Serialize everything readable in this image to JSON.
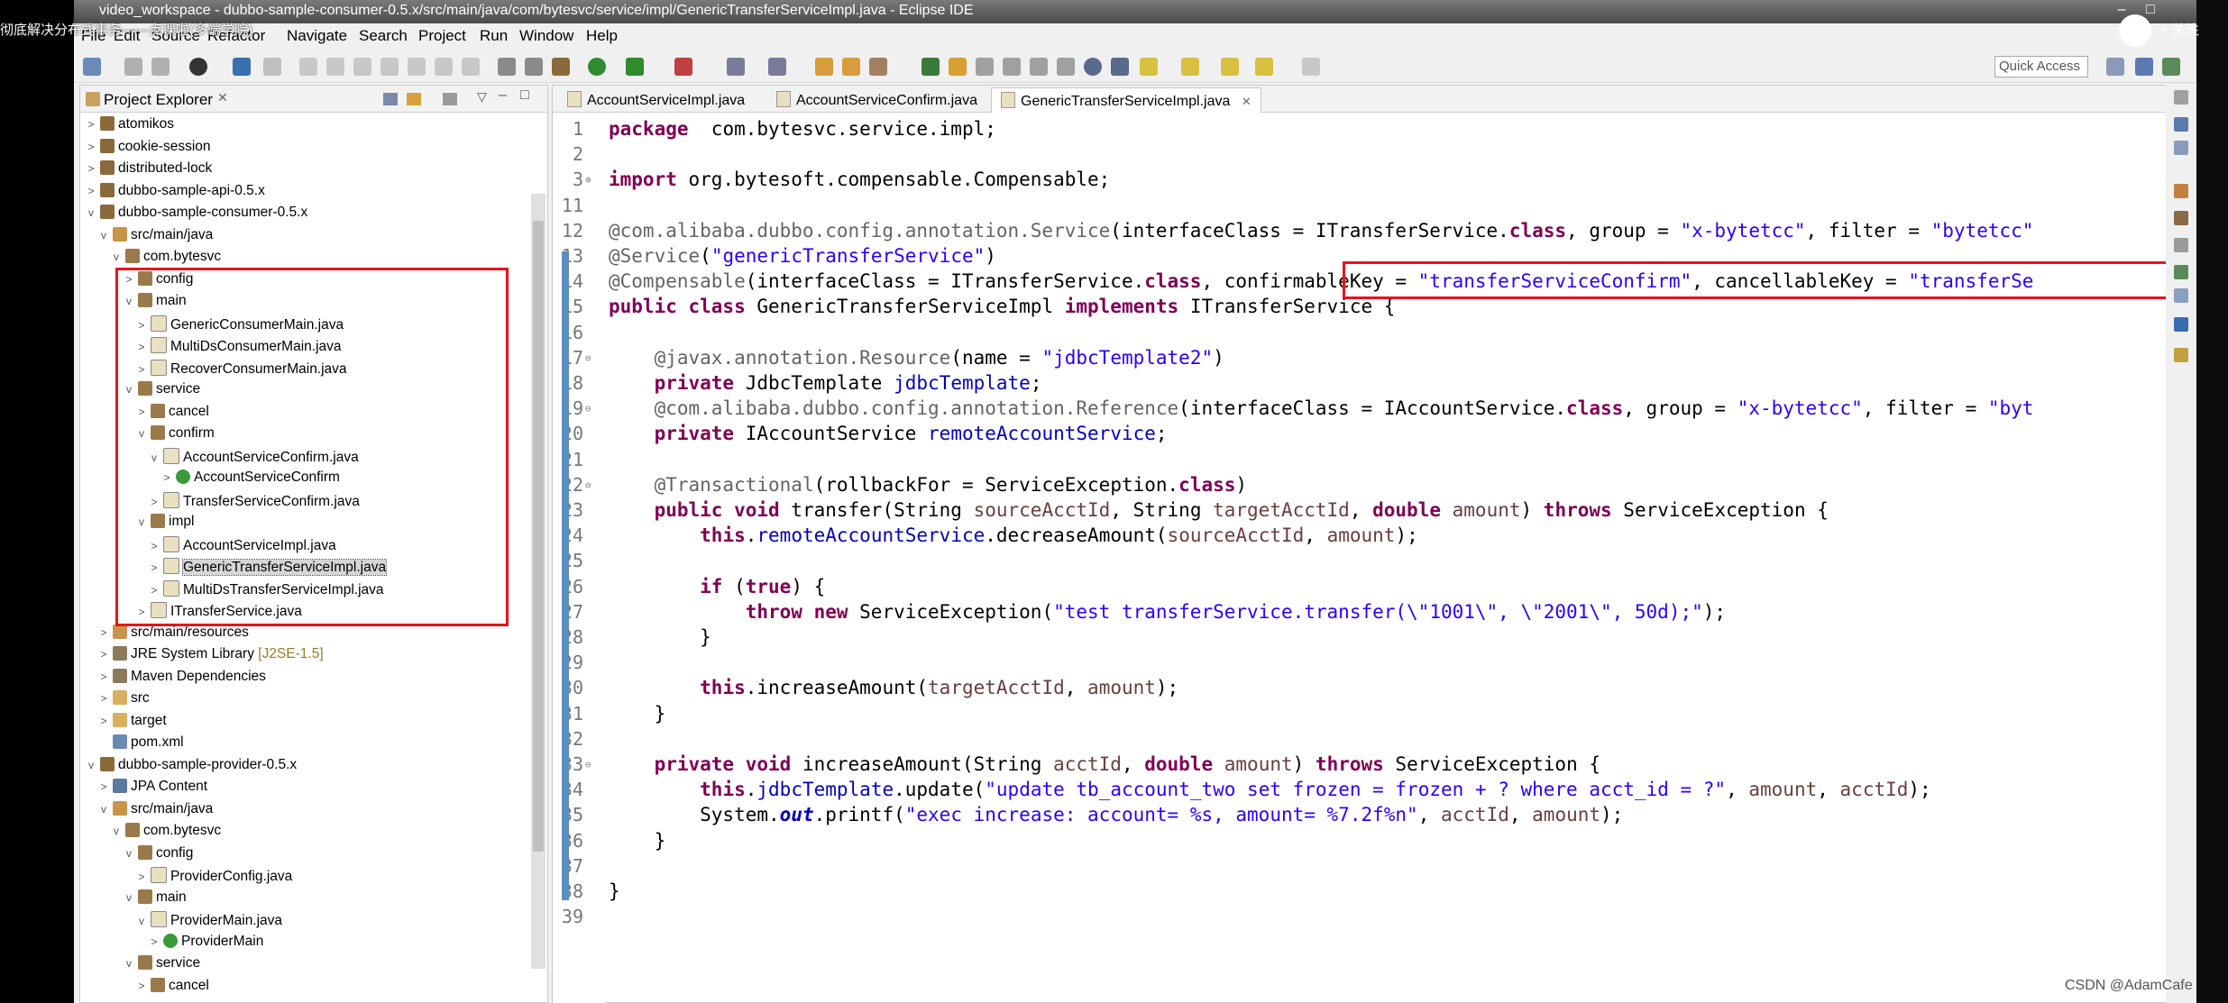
{
  "window": {
    "title": "video_workspace - dubbo-sample-consumer-0.5.x/src/main/java/com/bytesvc/service/impl/GenericTransferServiceImpl.java - Eclipse IDE"
  },
  "overlay": {
    "video_title": "彻底解决分布式事务——点课啦(多端学院)",
    "follow_label": "+ 关注"
  },
  "menubar": [
    "File",
    "Edit",
    "Source",
    "Refactor",
    "Navigate",
    "Search",
    "Project",
    "Run",
    "Window",
    "Help"
  ],
  "toolbar": {
    "quick_access": "Quick Access"
  },
  "project_explorer": {
    "title": "Project Explorer",
    "items": [
      {
        "label": "atomikos",
        "depth": 0,
        "twisty": ">",
        "icon": "project"
      },
      {
        "label": "cookie-session",
        "depth": 0,
        "twisty": ">",
        "icon": "project"
      },
      {
        "label": "distributed-lock",
        "depth": 0,
        "twisty": ">",
        "icon": "project"
      },
      {
        "label": "dubbo-sample-api-0.5.x",
        "depth": 0,
        "twisty": ">",
        "icon": "project"
      },
      {
        "label": "dubbo-sample-consumer-0.5.x",
        "depth": 0,
        "twisty": "v",
        "icon": "project"
      },
      {
        "label": "src/main/java",
        "depth": 1,
        "twisty": "v",
        "icon": "srcfolder"
      },
      {
        "label": "com.bytesvc",
        "depth": 2,
        "twisty": "v",
        "icon": "package"
      },
      {
        "label": "config",
        "depth": 3,
        "twisty": ">",
        "icon": "package"
      },
      {
        "label": "main",
        "depth": 3,
        "twisty": "v",
        "icon": "package"
      },
      {
        "label": "GenericConsumerMain.java",
        "depth": 4,
        "twisty": ">",
        "icon": "java"
      },
      {
        "label": "MultiDsConsumerMain.java",
        "depth": 4,
        "twisty": ">",
        "icon": "java"
      },
      {
        "label": "RecoverConsumerMain.java",
        "depth": 4,
        "twisty": ">",
        "icon": "java"
      },
      {
        "label": "service",
        "depth": 3,
        "twisty": "v",
        "icon": "package"
      },
      {
        "label": "cancel",
        "depth": 4,
        "twisty": ">",
        "icon": "package"
      },
      {
        "label": "confirm",
        "depth": 4,
        "twisty": "v",
        "icon": "package"
      },
      {
        "label": "AccountServiceConfirm.java",
        "depth": 5,
        "twisty": "v",
        "icon": "java"
      },
      {
        "label": "AccountServiceConfirm",
        "depth": 6,
        "twisty": ">",
        "icon": "class"
      },
      {
        "label": "TransferServiceConfirm.java",
        "depth": 5,
        "twisty": ">",
        "icon": "java"
      },
      {
        "label": "impl",
        "depth": 4,
        "twisty": "v",
        "icon": "package"
      },
      {
        "label": "AccountServiceImpl.java",
        "depth": 5,
        "twisty": ">",
        "icon": "java"
      },
      {
        "label": "GenericTransferServiceImpl.java",
        "depth": 5,
        "twisty": ">",
        "icon": "java",
        "selected": true
      },
      {
        "label": "MultiDsTransferServiceImpl.java",
        "depth": 5,
        "twisty": ">",
        "icon": "java"
      },
      {
        "label": "ITransferService.java",
        "depth": 4,
        "twisty": ">",
        "icon": "java"
      },
      {
        "label": "src/main/resources",
        "depth": 1,
        "twisty": ">",
        "icon": "srcfolder"
      },
      {
        "label": "JRE System Library",
        "deco": "[J2SE-1.5]",
        "depth": 1,
        "twisty": ">",
        "icon": "library"
      },
      {
        "label": "Maven Dependencies",
        "depth": 1,
        "twisty": ">",
        "icon": "library"
      },
      {
        "label": "src",
        "depth": 1,
        "twisty": ">",
        "icon": "folder"
      },
      {
        "label": "target",
        "depth": 1,
        "twisty": ">",
        "icon": "folder"
      },
      {
        "label": "pom.xml",
        "depth": 1,
        "twisty": "",
        "icon": "xml"
      },
      {
        "label": "dubbo-sample-provider-0.5.x",
        "depth": 0,
        "twisty": "v",
        "icon": "project"
      },
      {
        "label": "JPA Content",
        "depth": 1,
        "twisty": ">",
        "icon": "jpa"
      },
      {
        "label": "src/main/java",
        "depth": 1,
        "twisty": "v",
        "icon": "srcfolder"
      },
      {
        "label": "com.bytesvc",
        "depth": 2,
        "twisty": "v",
        "icon": "package"
      },
      {
        "label": "config",
        "depth": 3,
        "twisty": "v",
        "icon": "package"
      },
      {
        "label": "ProviderConfig.java",
        "depth": 4,
        "twisty": ">",
        "icon": "java"
      },
      {
        "label": "main",
        "depth": 3,
        "twisty": "v",
        "icon": "package"
      },
      {
        "label": "ProviderMain.java",
        "depth": 4,
        "twisty": "v",
        "icon": "java"
      },
      {
        "label": "ProviderMain",
        "depth": 5,
        "twisty": ">",
        "icon": "class"
      },
      {
        "label": "service",
        "depth": 3,
        "twisty": "v",
        "icon": "package"
      },
      {
        "label": "cancel",
        "depth": 4,
        "twisty": ">",
        "icon": "package"
      }
    ]
  },
  "editor": {
    "tabs": [
      {
        "label": "AccountServiceImpl.java",
        "active": false
      },
      {
        "label": "AccountServiceConfirm.java",
        "active": false
      },
      {
        "label": "GenericTransferServiceImpl.java",
        "active": true,
        "close": "✕"
      }
    ],
    "lines": [
      {
        "n": "1",
        "fold": "",
        "parts": [
          [
            "kw",
            "package"
          ],
          [
            "",
            "  com.bytesvc.service.impl;"
          ]
        ]
      },
      {
        "n": "2",
        "fold": "",
        "parts": []
      },
      {
        "n": "3",
        "fold": "⊕",
        "parts": [
          [
            "kw",
            "import"
          ],
          [
            "",
            " org.bytesoft.compensable.Compensable;"
          ]
        ]
      },
      {
        "n": "11",
        "fold": "",
        "parts": []
      },
      {
        "n": "12",
        "fold": "",
        "parts": [
          [
            "ann",
            "@com.alibaba.dubbo.config.annotation.Service"
          ],
          [
            "",
            "(interfaceClass = ITransferService."
          ],
          [
            "kw",
            "class"
          ],
          [
            "",
            ", group = "
          ],
          [
            "str",
            "\"x-bytetcc\""
          ],
          [
            "",
            ", filter = "
          ],
          [
            "str",
            "\"bytetcc\""
          ]
        ]
      },
      {
        "n": "13",
        "fold": "",
        "parts": [
          [
            "ann",
            "@Service"
          ],
          [
            "",
            "("
          ],
          [
            "str",
            "\"genericTransferService\""
          ],
          [
            "",
            ")"
          ]
        ]
      },
      {
        "n": "14",
        "fold": "",
        "parts": [
          [
            "ann",
            "@Compensable"
          ],
          [
            "",
            "(interfaceClass = ITransferService."
          ],
          [
            "kw",
            "class"
          ],
          [
            "",
            ", confirmableKey = "
          ],
          [
            "str",
            "\"transferServiceConfirm\""
          ],
          [
            "",
            ", cancellableKey = "
          ],
          [
            "str",
            "\"transferSe"
          ]
        ]
      },
      {
        "n": "15",
        "fold": "",
        "parts": [
          [
            "kw",
            "public class"
          ],
          [
            "",
            " GenericTransferServiceImpl "
          ],
          [
            "kw",
            "implements"
          ],
          [
            "",
            " ITransferService {"
          ]
        ]
      },
      {
        "n": "16",
        "fold": "",
        "parts": []
      },
      {
        "n": "17",
        "fold": "⊖",
        "parts": [
          [
            "",
            "    "
          ],
          [
            "ann",
            "@javax.annotation.Resource"
          ],
          [
            "",
            "(name = "
          ],
          [
            "str",
            "\"jdbcTemplate2\""
          ],
          [
            "",
            ")"
          ]
        ]
      },
      {
        "n": "18",
        "fold": "",
        "parts": [
          [
            "",
            "    "
          ],
          [
            "kw",
            "private"
          ],
          [
            "",
            " JdbcTemplate "
          ],
          [
            "fld",
            "jdbcTemplate"
          ],
          [
            "",
            ";"
          ]
        ]
      },
      {
        "n": "19",
        "fold": "⊖",
        "parts": [
          [
            "",
            "    "
          ],
          [
            "ann",
            "@com.alibaba.dubbo.config.annotation.Reference"
          ],
          [
            "",
            "(interfaceClass = IAccountService."
          ],
          [
            "kw",
            "class"
          ],
          [
            "",
            ", group = "
          ],
          [
            "str",
            "\"x-bytetcc\""
          ],
          [
            "",
            ", filter = "
          ],
          [
            "str",
            "\"byt"
          ]
        ]
      },
      {
        "n": "20",
        "fold": "",
        "parts": [
          [
            "",
            "    "
          ],
          [
            "kw",
            "private"
          ],
          [
            "",
            " IAccountService "
          ],
          [
            "fld",
            "remoteAccountService"
          ],
          [
            "",
            ";"
          ]
        ]
      },
      {
        "n": "21",
        "fold": "",
        "parts": []
      },
      {
        "n": "22",
        "fold": "⊖",
        "parts": [
          [
            "",
            "    "
          ],
          [
            "ann",
            "@Transactional"
          ],
          [
            "",
            "(rollbackFor = ServiceException."
          ],
          [
            "kw",
            "class"
          ],
          [
            "",
            ")"
          ]
        ]
      },
      {
        "n": "23",
        "fold": "",
        "parts": [
          [
            "",
            "    "
          ],
          [
            "kw",
            "public void"
          ],
          [
            "",
            " transfer(String "
          ],
          [
            "par",
            "sourceAcctId"
          ],
          [
            "",
            ", String "
          ],
          [
            "par",
            "targetAcctId"
          ],
          [
            "",
            ", "
          ],
          [
            "kw",
            "double"
          ],
          [
            "",
            " "
          ],
          [
            "par",
            "amount"
          ],
          [
            "",
            ") "
          ],
          [
            "kw",
            "throws"
          ],
          [
            "",
            " ServiceException {"
          ]
        ]
      },
      {
        "n": "24",
        "fold": "",
        "parts": [
          [
            "",
            "        "
          ],
          [
            "kw",
            "this"
          ],
          [
            "",
            "."
          ],
          [
            "fld",
            "remoteAccountService"
          ],
          [
            "",
            ".decreaseAmount("
          ],
          [
            "par",
            "sourceAcctId"
          ],
          [
            "",
            ", "
          ],
          [
            "par",
            "amount"
          ],
          [
            "",
            ");"
          ]
        ]
      },
      {
        "n": "25",
        "fold": "",
        "parts": []
      },
      {
        "n": "26",
        "fold": "",
        "parts": [
          [
            "",
            "        "
          ],
          [
            "kw",
            "if"
          ],
          [
            "",
            " ("
          ],
          [
            "kw",
            "true"
          ],
          [
            "",
            ") {"
          ]
        ]
      },
      {
        "n": "27",
        "fold": "",
        "parts": [
          [
            "",
            "            "
          ],
          [
            "kw",
            "throw new"
          ],
          [
            "",
            " ServiceException("
          ],
          [
            "str",
            "\"test transferService.transfer(\\\"1001\\\", \\\"2001\\\", 50d);\""
          ],
          [
            "",
            ");"
          ]
        ]
      },
      {
        "n": "28",
        "fold": "",
        "parts": [
          [
            "",
            "        }"
          ]
        ]
      },
      {
        "n": "29",
        "fold": "",
        "parts": []
      },
      {
        "n": "30",
        "fold": "",
        "parts": [
          [
            "",
            "        "
          ],
          [
            "kw",
            "this"
          ],
          [
            "",
            ".increaseAmount("
          ],
          [
            "par",
            "targetAcctId"
          ],
          [
            "",
            ", "
          ],
          [
            "par",
            "amount"
          ],
          [
            "",
            ");"
          ]
        ]
      },
      {
        "n": "31",
        "fold": "",
        "parts": [
          [
            "",
            "    }"
          ]
        ]
      },
      {
        "n": "32",
        "fold": "",
        "parts": []
      },
      {
        "n": "33",
        "fold": "⊖",
        "parts": [
          [
            "",
            "    "
          ],
          [
            "kw",
            "private void"
          ],
          [
            "",
            " increaseAmount(String "
          ],
          [
            "par",
            "acctId"
          ],
          [
            "",
            ", "
          ],
          [
            "kw",
            "double"
          ],
          [
            "",
            " "
          ],
          [
            "par",
            "amount"
          ],
          [
            "",
            ") "
          ],
          [
            "kw",
            "throws"
          ],
          [
            "",
            " ServiceException {"
          ]
        ]
      },
      {
        "n": "34",
        "fold": "",
        "parts": [
          [
            "",
            "        "
          ],
          [
            "kw",
            "this"
          ],
          [
            "",
            "."
          ],
          [
            "fld",
            "jdbcTemplate"
          ],
          [
            "",
            ".update("
          ],
          [
            "str",
            "\"update tb_account_two set frozen = frozen + ? where acct_id = ?\""
          ],
          [
            "",
            ", "
          ],
          [
            "par",
            "amount"
          ],
          [
            "",
            ", "
          ],
          [
            "par",
            "acctId"
          ],
          [
            "",
            ");"
          ]
        ]
      },
      {
        "n": "35",
        "fold": "",
        "parts": [
          [
            "",
            "        System."
          ],
          [
            "sfld",
            "out"
          ],
          [
            "",
            ".printf("
          ],
          [
            "str",
            "\"exec increase: account= %s, amount= %7.2f%n\""
          ],
          [
            "",
            ", "
          ],
          [
            "par",
            "acctId"
          ],
          [
            "",
            ", "
          ],
          [
            "par",
            "amount"
          ],
          [
            "",
            ");"
          ]
        ]
      },
      {
        "n": "36",
        "fold": "",
        "parts": [
          [
            "",
            "    }"
          ]
        ]
      },
      {
        "n": "37",
        "fold": "",
        "parts": []
      },
      {
        "n": "38",
        "fold": "",
        "parts": [
          [
            "",
            "}"
          ]
        ]
      },
      {
        "n": "39",
        "fold": "",
        "parts": []
      }
    ]
  },
  "watermark": "CSDN @AdamCafe",
  "colors": {
    "highlight_box": "#e8141c",
    "keyword": "#7f0055",
    "string": "#2a00ff",
    "annotation": "#646464",
    "field": "#0000c0",
    "parameter": "#6a3e3e"
  }
}
